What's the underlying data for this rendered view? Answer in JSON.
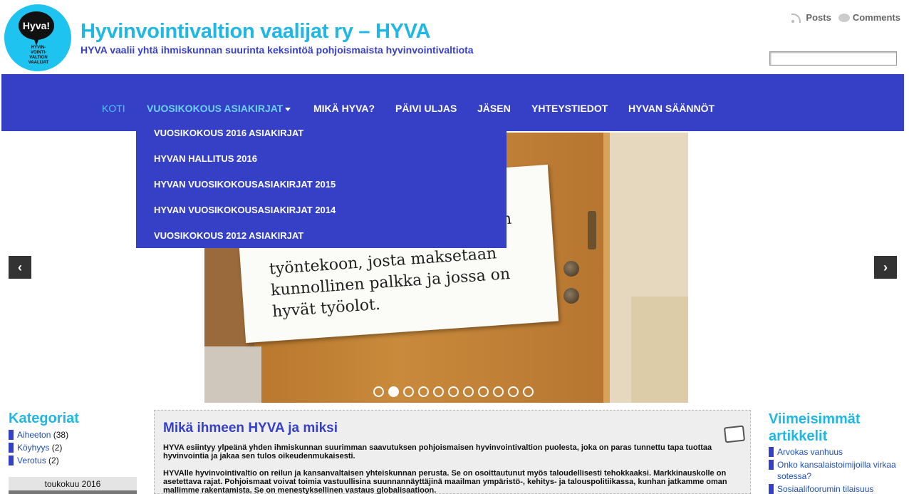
{
  "header": {
    "logo_text": "Hyva!",
    "logo_small": "HYVIN-\nVOINTI-\nVALTION\nVAALIJAT",
    "site_title": "Hyvinvointivaltion vaalijat ry – HYVA",
    "site_description": "HYVA vaalii yhtä ihmiskunnan suurinta keksintöä pohjoismaista hyvinvointivaltiota",
    "posts_link": "Posts",
    "comments_link": "Comments",
    "search_value": ""
  },
  "nav": {
    "items": [
      {
        "label": "KOTI"
      },
      {
        "label": "VUOSIKOKOUS ASIAKIRJAT"
      },
      {
        "label": "MIKÄ HYVA?"
      },
      {
        "label": "PÄIVI ULJAS"
      },
      {
        "label": "JÄSEN"
      },
      {
        "label": "YHTEYSTIEDOT"
      },
      {
        "label": "HYVAN SÄÄNNÖT"
      }
    ],
    "dropdown": [
      {
        "label": "VUOSIKOKOUS 2016 ASIAKIRJAT"
      },
      {
        "label": "HYVAN HALLITUS 2016"
      },
      {
        "label": "HYVAN VUOSIKOKOUSASIAKIRJAT 2015"
      },
      {
        "label": "HYVAN VUOSIKOKOUSASIAKIRJAT 2014"
      },
      {
        "label": "VUOSIKOKOUS 2012 ASIAKIRJAT"
      }
    ]
  },
  "slider": {
    "paper_lines": [
      "työntekoon, josta maksetaan",
      "kunnollinen palkka ja jossa on",
      "hyvät työolot."
    ],
    "paper_partial": "n",
    "slide_count": 11,
    "active_slide": 2,
    "prev_label": "‹",
    "next_label": "›"
  },
  "sidebar_left": {
    "title": "Kategoriat",
    "categories": [
      {
        "name": "Aiheeton",
        "count": "(38)"
      },
      {
        "name": "Köyhyys",
        "count": "(2)"
      },
      {
        "name": "Verotus",
        "count": "(2)"
      }
    ],
    "calendar_caption": "toukokuu 2016"
  },
  "post": {
    "title": "Mikä ihmeen HYVA ja miksi",
    "paragraph1": "HYVA esiintyy ylpeänä yhden ihmiskunnan suurimman saavutuksen pohjoismaisen hyvinvointivaltion puolesta, joka on paras tunnettu tapa tuottaa hyvinvointia ja jakaa sen tulos oikeudenmukaisesti.",
    "paragraph2": "HYVAlle hyvinvointivaltio on reilun ja kansanvaltaisen yhteiskunnan perusta. Se on osoittautunut myös taloudellisesti tehokkaaksi. Markkinauskolle on asetettava rajat. Pohjoismaat voivat toimia vastuullisina suunnannäyttäjinä maailman ympäristö-, kehitys- ja talouspolitiikassa, kunhan jatkamme oman mallimme rakentamista. Se on menestyksellinen vastaus globalisaatioon."
  },
  "sidebar_right": {
    "title": "Viimeisimmät artikkelit",
    "articles": [
      {
        "title": "Arvokas vanhuus"
      },
      {
        "title": "Onko kansalaistoimijoilla virkaa sotessa?"
      },
      {
        "title": "Sosiaalifoorumin tilaisuus"
      }
    ]
  },
  "colors": {
    "nav_bg": "#3540c7",
    "title_cyan": "#1eb7e6",
    "accent_blue": "#3540c7"
  }
}
